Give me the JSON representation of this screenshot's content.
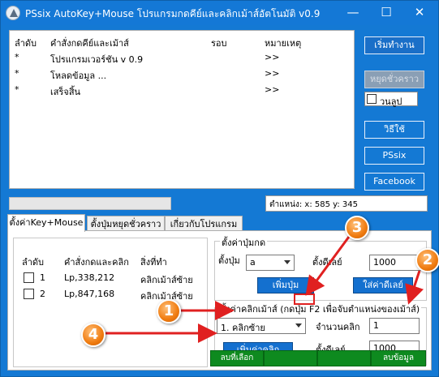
{
  "window": {
    "title": "PSsix AutoKey+Mouse โปรแกรมกดคีย์และคลิกเม้าส์อัตโนมัติ v0.9",
    "minimize": "—",
    "maximize": "☐",
    "close": "✕"
  },
  "log": {
    "headers": [
      "ลำดับ",
      "คำสั่งกดคีย์และเม้าส์",
      "รอบ",
      "หมายเหตุ"
    ],
    "rows": [
      {
        "col1": "*",
        "col2": "โปรแกรมเวอร์ชัน v 0.9",
        "col3": "",
        "col4": ">>"
      },
      {
        "col1": "*",
        "col2": "โหลดข้อมูล ...",
        "col3": "",
        "col4": ">>"
      },
      {
        "col1": "*",
        "col2": "เสร็จสิ้น",
        "col3": "",
        "col4": ">>"
      }
    ]
  },
  "side": {
    "start": "เริ่มทำงาน",
    "pause": "หยุดชั่วคราว",
    "loop": "วนลูป",
    "howto": "วิธีใช้",
    "pssix": "PSsix",
    "facebook": "Facebook"
  },
  "status": {
    "position_text": "ตำแหน่ง: x: 585 y: 345"
  },
  "tabs": [
    "ตั้งค่าKey+Mouse",
    "ตั้งปุ่มหยุดชั่วคราว",
    "เกี่ยวกับโปรแกรม"
  ],
  "actions": {
    "headers": [
      "ลำดับ",
      "คำสั่งกดและคลิก",
      "สิ่งที่ทำ"
    ],
    "rows": [
      {
        "num": "1",
        "cmd": "Lp,338,212",
        "what": "คลิกเม้าส์ซ้าย"
      },
      {
        "num": "2",
        "cmd": "Lp,847,168",
        "what": "คลิกเม้าส์ซ้าย"
      }
    ]
  },
  "key_group": {
    "title": "ตั้งค่าปุ่มกด",
    "key_label": "ตั้งปุ่ม",
    "key_value": "a",
    "delay_label": "ตั้งดีเลย์",
    "delay_value": "1000",
    "add_key": "เพิ่มปุ่ม",
    "set_delay": "ใส่ค่าดีเลย์"
  },
  "mouse_group": {
    "title": "ตั้งค่าคลิกเม้าส์ (กดปุ่ม F2 เพื่อจับตำแหน่งของเม้าส์)",
    "click_type": "1. คลิกซ้าย",
    "count_label": "จำนวนคลิก",
    "count_value": "1",
    "add_click": "เพิ่มค่าคลิก",
    "delay_label": "ตั้งดีเลย์",
    "delay_value": "1000"
  },
  "bottom": {
    "delete_selected": "ลบที่เลือก",
    "b2": "",
    "b3": "",
    "delete_all": "ลบข้อมูล"
  },
  "annotations": [
    "1",
    "2",
    "3",
    "4"
  ],
  "colors": {
    "titlebar": "#1478d6",
    "accent_green": "#0e8a1f",
    "badge_orange": "#f07c10",
    "highlight_red": "#e02020"
  }
}
